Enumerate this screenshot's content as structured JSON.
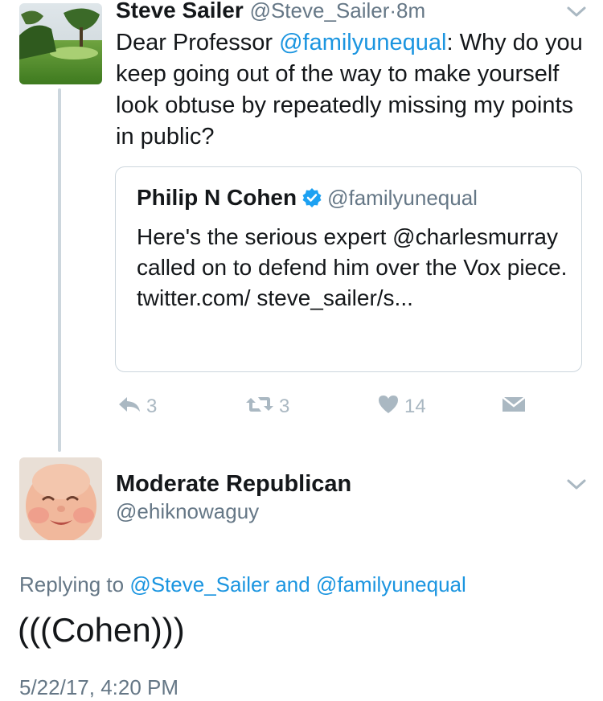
{
  "colors": {
    "link": "#1b95e0",
    "secondary_text": "#657786",
    "action_icon": "#aab8c2",
    "border": "#ccd6dd",
    "verified": "#1da1f2"
  },
  "tweet": {
    "author_name": "Steve Sailer",
    "handle": "@Steve_Sailer",
    "separator": "·",
    "time": "8m",
    "avatar_icon": "golf-course-photo-avatar",
    "text_before": "Dear Professor ",
    "text_mention": "@familyunequal",
    "text_after": ": Why do you keep going out of the way to make yourself look obtuse by repeatedly missing my points in public?",
    "quoted": {
      "author_name": "Philip N Cohen",
      "verified_icon": "verified-badge-icon",
      "handle": "@familyunequal",
      "text": "Here's the serious expert @charlesmurray called on to defend him over the Vox piece. twitter.com/ steve_sailer/s..."
    },
    "actions": {
      "reply_count": "3",
      "retweet_count": "3",
      "like_count": "14"
    }
  },
  "reply": {
    "author_name": "Moderate Republican",
    "handle": "@ehiknowaguy",
    "avatar_icon": "baby-face-photo-avatar",
    "replying_prefix": "Replying to ",
    "replying_mention1": "@Steve_Sailer",
    "replying_and": " and ",
    "replying_mention2": "@familyunequal",
    "text": "(((Cohen)))",
    "timestamp": "5/22/17, 4:20 PM"
  }
}
